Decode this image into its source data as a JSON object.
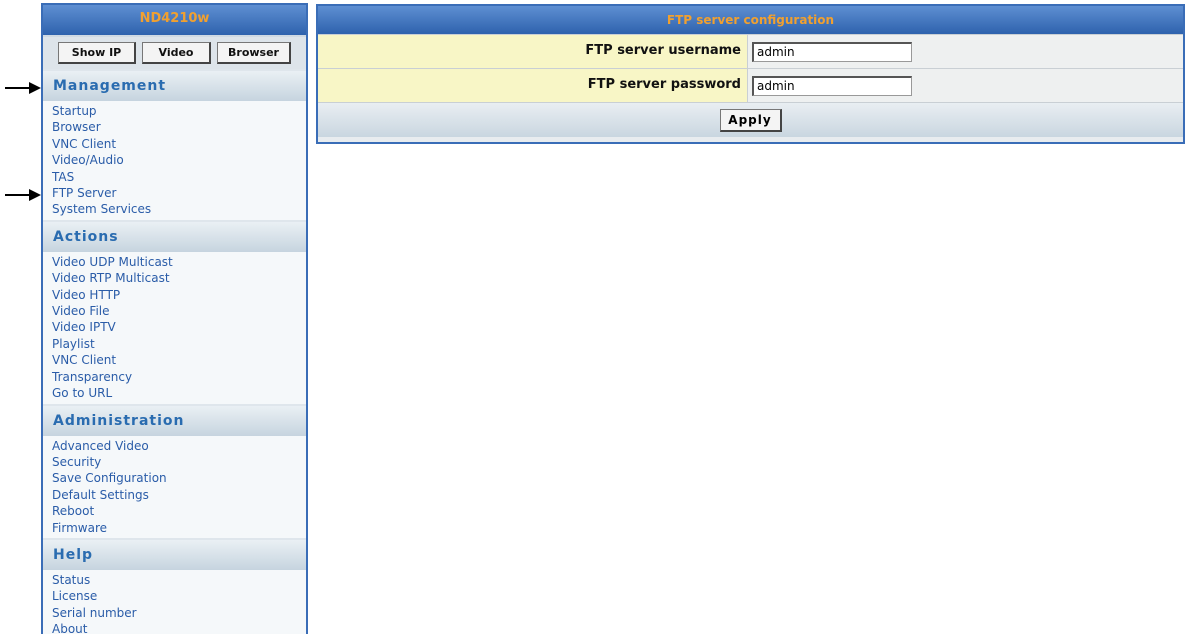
{
  "device": {
    "name": "ND4210w"
  },
  "quick_buttons": [
    {
      "label": "Show IP"
    },
    {
      "label": "Video"
    },
    {
      "label": "Browser"
    }
  ],
  "sections": [
    {
      "title": "Management",
      "items": [
        "Startup",
        "Browser",
        "VNC Client",
        "Video/Audio",
        "TAS",
        "FTP Server",
        "System Services"
      ]
    },
    {
      "title": "Actions",
      "items": [
        "Video UDP Multicast",
        "Video RTP Multicast",
        "Video HTTP",
        "Video File",
        "Video IPTV",
        "Playlist",
        "VNC Client",
        "Transparency",
        "Go to URL"
      ]
    },
    {
      "title": "Administration",
      "items": [
        "Advanced Video",
        "Security",
        "Save Configuration",
        "Default Settings",
        "Reboot",
        "Firmware"
      ]
    },
    {
      "title": "Help",
      "items": [
        "Status",
        "License",
        "Serial number",
        "About"
      ]
    }
  ],
  "config": {
    "title": "FTP server configuration",
    "username_label": "FTP server username",
    "username_value": "admin",
    "password_label": "FTP server password",
    "password_value": "admin",
    "apply_label": "Apply"
  },
  "colors": {
    "header_blue": "#3a6db7",
    "header_text_orange": "#f0a030",
    "menu_link": "#2a5ca8",
    "label_bg_yellow": "#f8f6c6"
  }
}
